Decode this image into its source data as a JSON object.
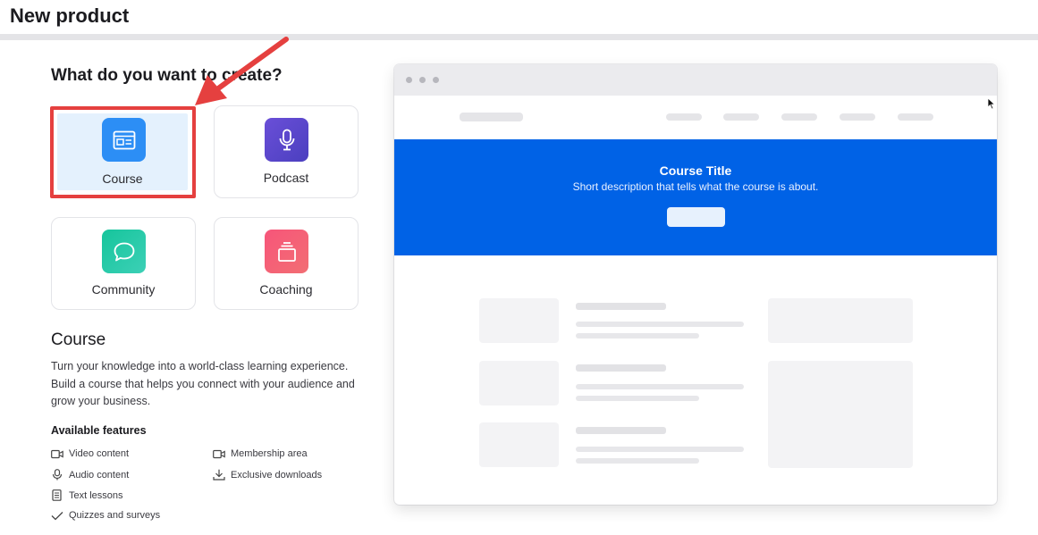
{
  "page": {
    "title": "New product"
  },
  "question": "What do you want to create?",
  "cards": [
    {
      "key": "course",
      "label": "Course",
      "icon": "course-icon",
      "color": "#2c8ef5",
      "selected": true
    },
    {
      "key": "podcast",
      "label": "Podcast",
      "icon": "microphone-icon",
      "color": "#5a4bcf",
      "selected": false
    },
    {
      "key": "community",
      "label": "Community",
      "icon": "chat-bubble-icon",
      "color": "#1fc4a0",
      "selected": false
    },
    {
      "key": "coaching",
      "label": "Coaching",
      "icon": "coaching-icon",
      "color": "#f0566b",
      "selected": false
    }
  ],
  "details": {
    "title": "Course",
    "description": "Turn your knowledge into a world-class learning experience. Build a course that helps you connect with your audience and grow your business.",
    "features_title": "Available features",
    "features": [
      {
        "label": "Video content",
        "icon": "video-icon"
      },
      {
        "label": "Audio content",
        "icon": "microphone-icon"
      },
      {
        "label": "Text lessons",
        "icon": "document-icon"
      },
      {
        "label": "Quizzes and surveys",
        "icon": "checkmark-icon"
      },
      {
        "label": "Membership area",
        "icon": "video-icon"
      },
      {
        "label": "Exclusive downloads",
        "icon": "download-icon"
      }
    ]
  },
  "preview": {
    "hero_title": "Course Title",
    "hero_description": "Short description that tells what the course is about.",
    "hero_color": "#0062e6"
  },
  "annotation": {
    "color": "#e5403f"
  }
}
